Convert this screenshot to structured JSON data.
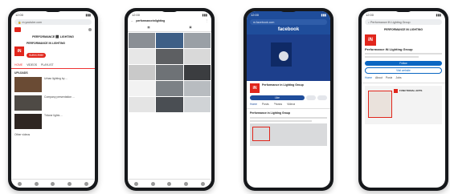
{
  "phones": [
    {
      "app": "youtube",
      "url": "m.youtube.com",
      "channel_line": "PERFORMANCE ⬛ LIGHTING",
      "channel_name": "PERFORMANCE IN LIGHTING",
      "tabs": [
        "HOME",
        "VIDEOS",
        "PLAYLIST",
        "CH"
      ],
      "section": "UPLOADS",
      "videos": [
        {
          "title": "Urban lighting by ..."
        },
        {
          "title": "Company presentation ..."
        },
        {
          "title": "Tritone lights ..."
        }
      ],
      "footer": "Other videos"
    },
    {
      "app": "instagram",
      "url": "performanceinlighting",
      "grid_count": 12
    },
    {
      "app": "facebook",
      "url": "m.facebook.com",
      "brand": "facebook",
      "page_name": "Performance in Lighting Group",
      "like_label": "Like",
      "tabs": [
        "Home",
        "Posts",
        "Photos",
        "Videos"
      ],
      "post_author": "Performance in Lighting Group"
    },
    {
      "app": "linkedin",
      "url": "Performance iN Lighting Group",
      "company_line": "PERFORMANCE IN LIGHTING",
      "company_name": "Performance iN Lighting Group",
      "follow_label": "Follow",
      "visit_label": "Visit website",
      "tabs": [
        "Home",
        "About",
        "Posts",
        "Jobs",
        "People"
      ],
      "post_tag": "FUNCTIONAL ARTS"
    }
  ],
  "colors": {
    "youtube_red": "#e1261c",
    "facebook_blue": "#1f4d9b",
    "linkedin_blue": "#0a66c2",
    "phone_frame": "#16181b"
  }
}
